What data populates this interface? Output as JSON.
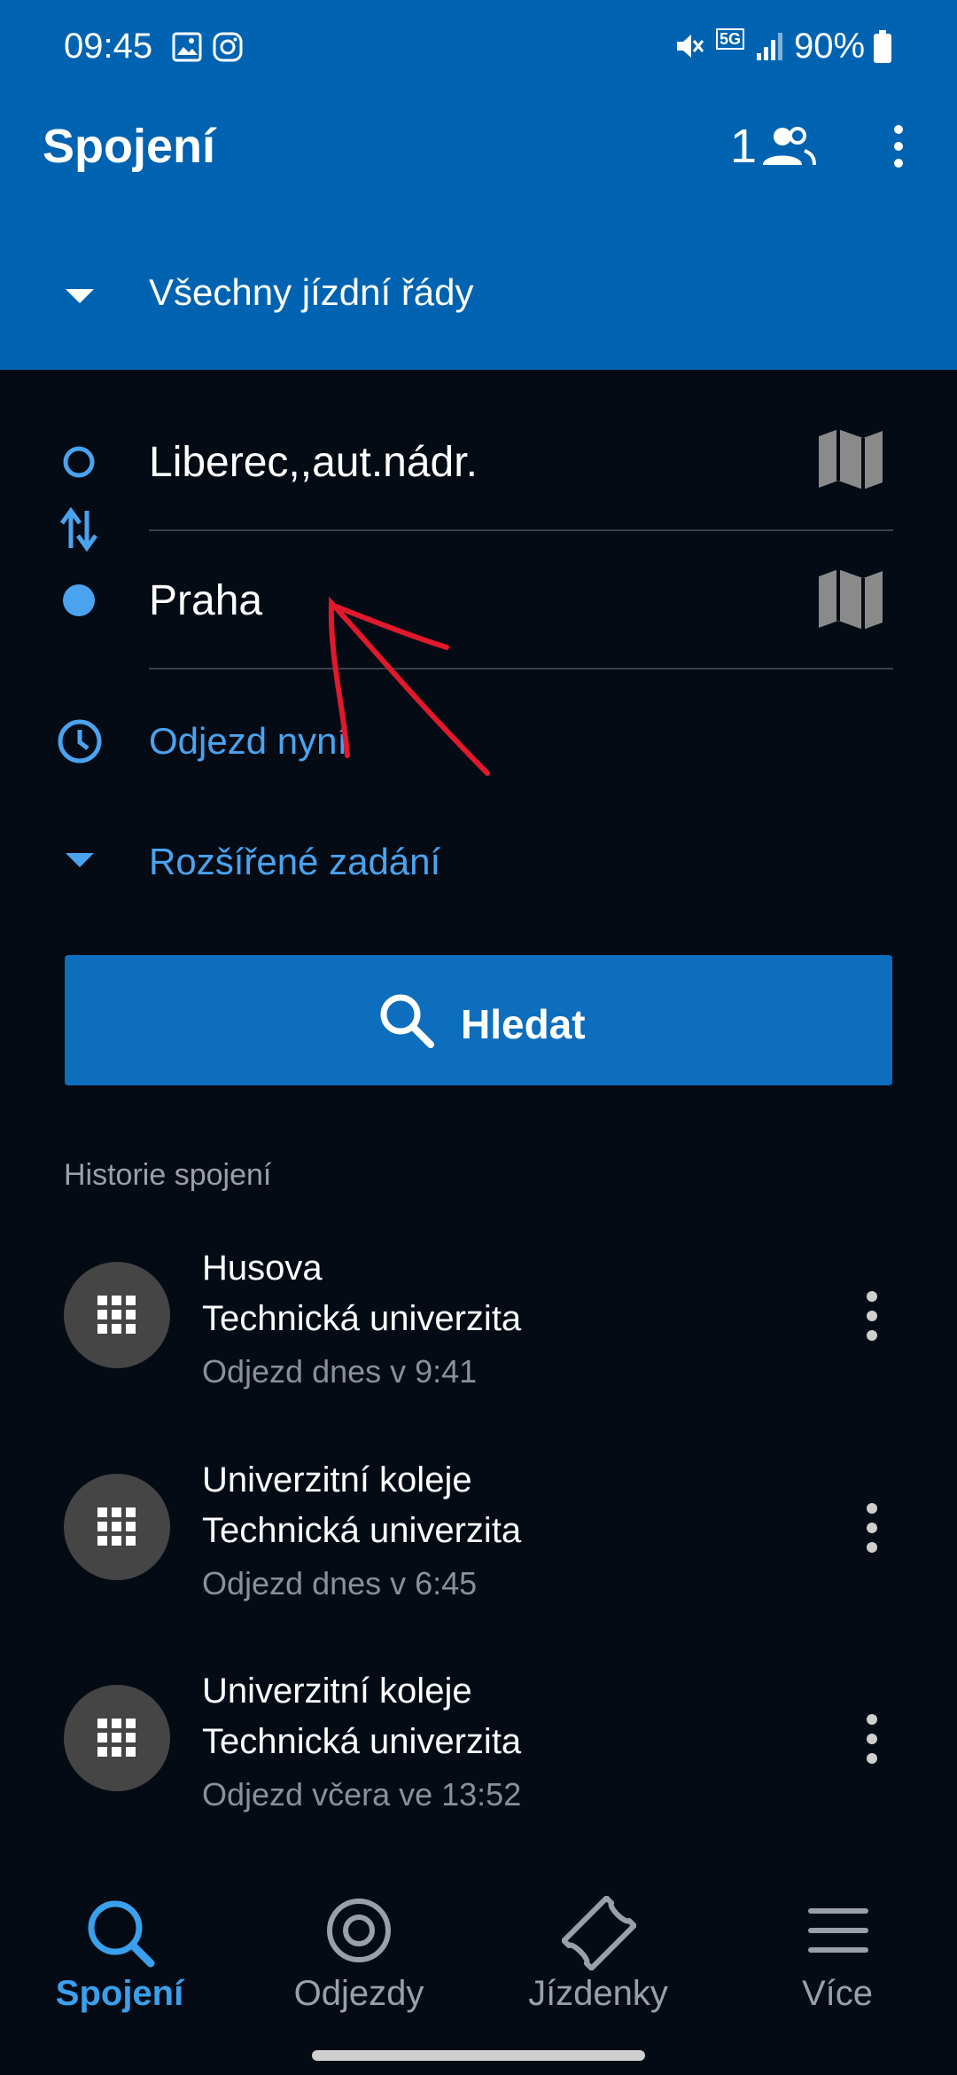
{
  "status_bar": {
    "time": "09:45",
    "battery": "90%",
    "network": "5G"
  },
  "header": {
    "title": "Spojení",
    "passenger_count": "1",
    "timetable_selector": "Všechny jízdní řády"
  },
  "form": {
    "from": "Liberec,,aut.nádr.",
    "to": "Praha",
    "departure": "Odjezd nyní",
    "advanced": "Rozšířené zadání",
    "search_button": "Hledat"
  },
  "history": {
    "title": "Historie spojení",
    "items": [
      {
        "from": "Husova",
        "to": "Technická univerzita",
        "when": "Odjezd dnes v 9:41"
      },
      {
        "from": "Univerzitní koleje",
        "to": "Technická univerzita",
        "when": "Odjezd dnes v 6:45"
      },
      {
        "from": "Univerzitní koleje",
        "to": "Technická univerzita",
        "when": "Odjezd včera ve 13:52"
      }
    ]
  },
  "bottom_nav": {
    "items": [
      {
        "label": "Spojení",
        "icon": "search-icon",
        "active": true
      },
      {
        "label": "Odjezdy",
        "icon": "target-icon",
        "active": false
      },
      {
        "label": "Jízdenky",
        "icon": "ticket-icon",
        "active": false
      },
      {
        "label": "Více",
        "icon": "menu-icon",
        "active": false
      }
    ]
  },
  "colors": {
    "header": "#0063b1",
    "background": "#040b15",
    "accent": "#4aa3ef",
    "button": "#0d6ebd",
    "annotation": "#e0192c"
  }
}
